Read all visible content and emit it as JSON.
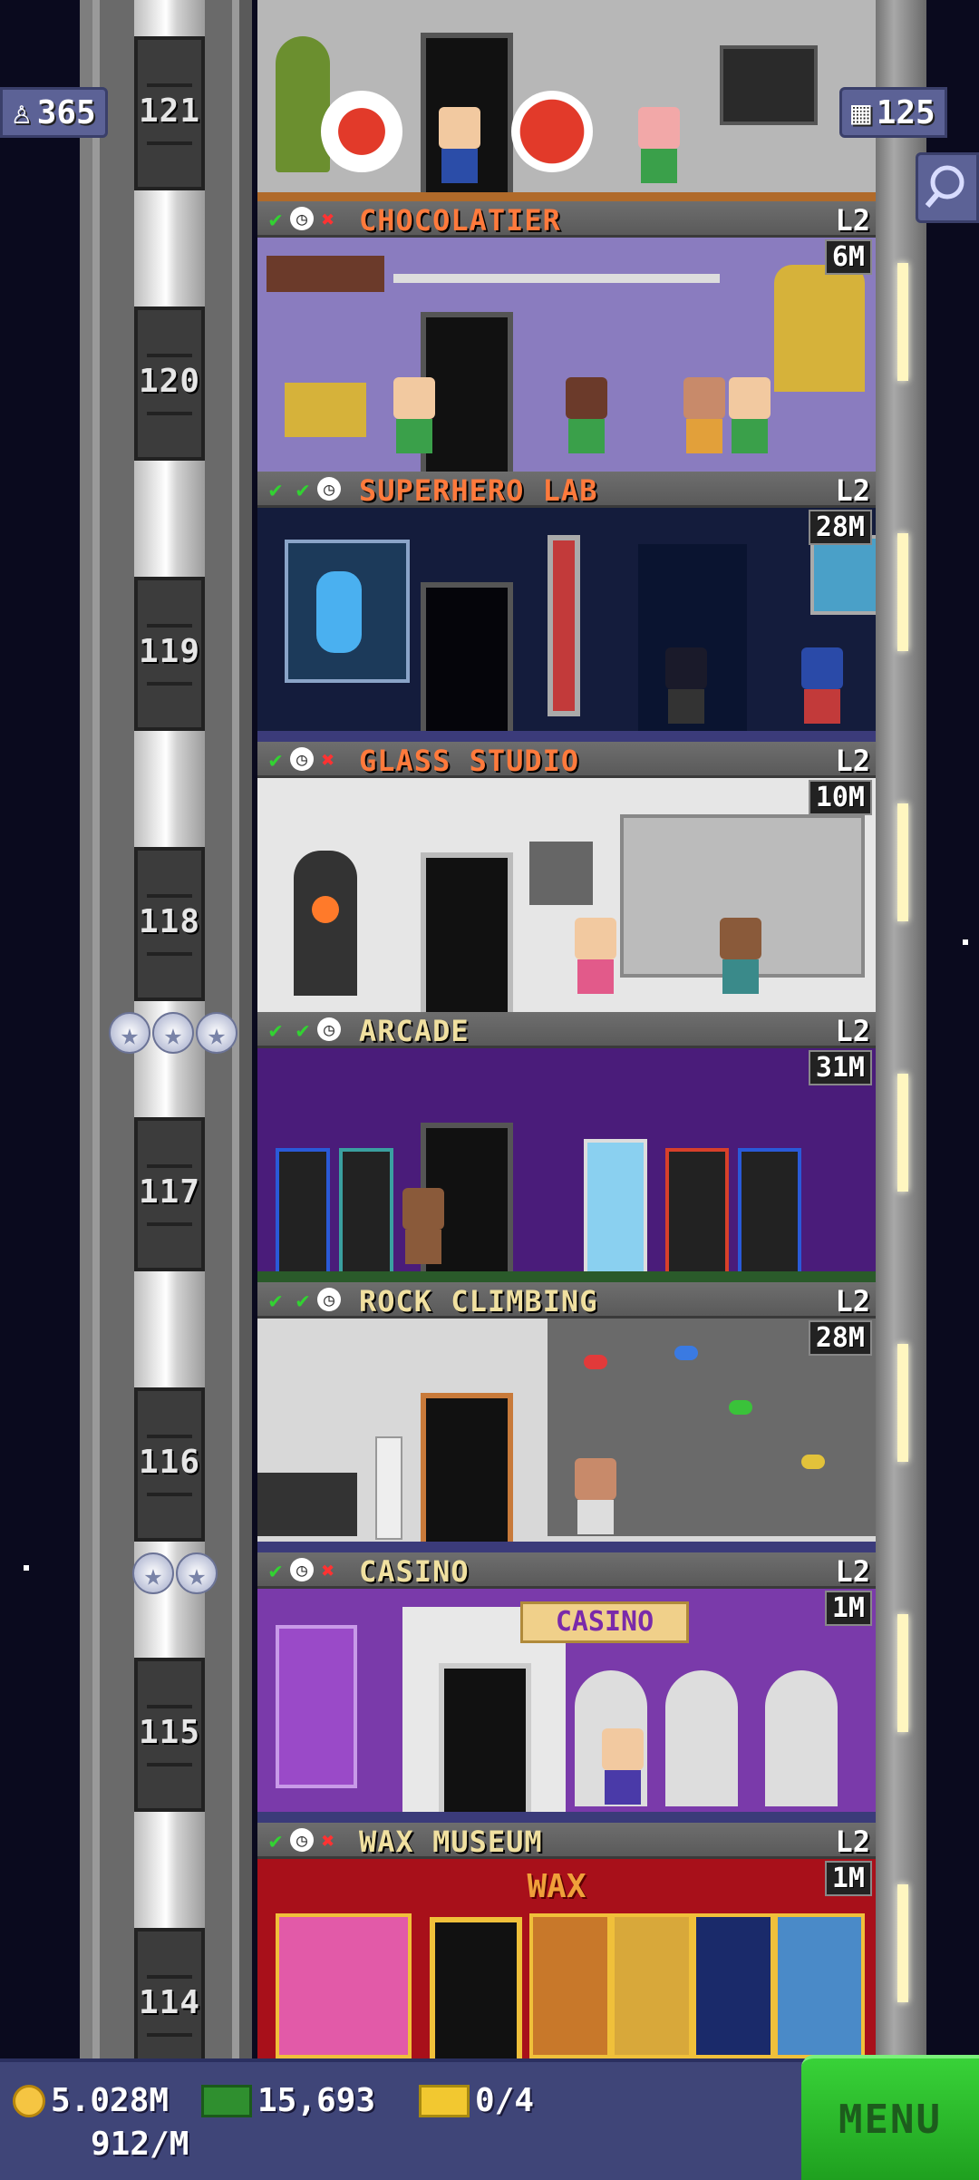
{
  "top_badges": {
    "population": "365",
    "floors": "125"
  },
  "elevator_floors": [
    "121",
    "120",
    "119",
    "118",
    "117",
    "116",
    "115",
    "114"
  ],
  "rooms": [
    {
      "name": "CHOCOLATIER",
      "level": "L2",
      "earn": "6M",
      "status": [
        "check",
        "clock",
        "x"
      ],
      "name_color": "orange"
    },
    {
      "name": "SUPERHERO LAB",
      "level": "L2",
      "earn": "28M",
      "status": [
        "check",
        "check",
        "clock"
      ],
      "name_color": "orange"
    },
    {
      "name": "GLASS STUDIO",
      "level": "L2",
      "earn": "10M",
      "status": [
        "check",
        "clock",
        "x"
      ],
      "name_color": "orange"
    },
    {
      "name": "ARCADE",
      "level": "L2",
      "earn": "31M",
      "status": [
        "check",
        "check",
        "clock"
      ],
      "name_color": "yellow"
    },
    {
      "name": "ROCK CLIMBING",
      "level": "L2",
      "earn": "28M",
      "status": [
        "check",
        "check",
        "clock"
      ],
      "name_color": "yellow"
    },
    {
      "name": "CASINO",
      "level": "L2",
      "earn": "1M",
      "status": [
        "check",
        "clock",
        "x"
      ],
      "name_color": "yellow"
    },
    {
      "name": "WAX MUSEUM",
      "level": "L2",
      "earn": "1M",
      "status": [
        "check",
        "clock",
        "x"
      ],
      "name_color": "yellow"
    }
  ],
  "signs": {
    "casino": "CASINO",
    "wax": "WAX"
  },
  "bottom_bar": {
    "coins": "5.028M",
    "coin_rate": "912/M",
    "bux": "15,693",
    "tickets": "0/4",
    "menu_label": "MENU"
  },
  "icons": {
    "population": "person-icon",
    "floors": "building-icon",
    "search": "magnifier-icon",
    "coin": "coin-icon",
    "bux": "tower-bux-icon",
    "ticket": "golden-ticket-icon"
  }
}
